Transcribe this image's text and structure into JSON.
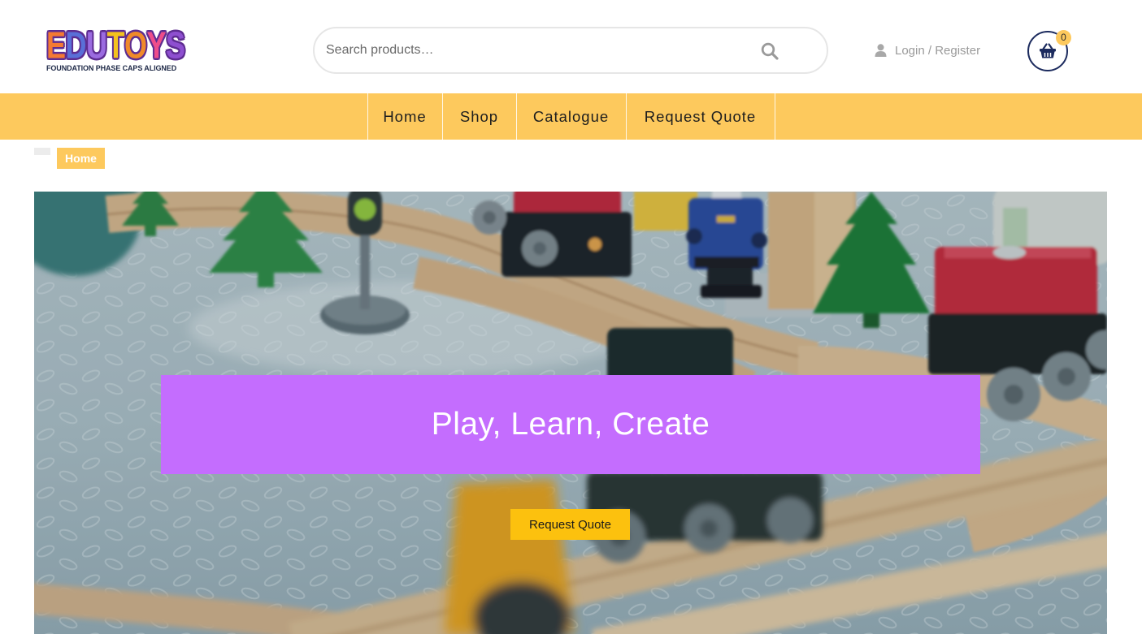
{
  "header": {
    "logo": {
      "letters": [
        {
          "char": "E",
          "color": "#f47a33"
        },
        {
          "char": "D",
          "color": "#5a6fd8"
        },
        {
          "char": "U",
          "color": "#9b6be0"
        },
        {
          "char": "T",
          "color": "#f4c21e"
        },
        {
          "char": "O",
          "color": "#f08a2a"
        },
        {
          "char": "Y",
          "color": "#ee4d8a"
        },
        {
          "char": "S",
          "color": "#8e4fd0"
        }
      ],
      "outline_color": "#5e2d91",
      "tagline": "FOUNDATION PHASE CAPS ALIGNED"
    },
    "search": {
      "placeholder": "Search products…",
      "value": "",
      "icon": "search-icon"
    },
    "account": {
      "icon": "user-icon",
      "label": "Login / Register"
    },
    "cart": {
      "icon": "basket-icon",
      "count": "0",
      "color": "#1c2b5e",
      "badge_color": "#fdc95d"
    }
  },
  "nav": {
    "background": "#fdc95d",
    "items": [
      {
        "label": "Home"
      },
      {
        "label": "Shop"
      },
      {
        "label": "Catalogue"
      },
      {
        "label": "Request Quote"
      }
    ]
  },
  "breadcrumb": {
    "active_color": "#fdc95d",
    "items": [
      {
        "label": ""
      },
      {
        "label": "Home",
        "active": true
      }
    ]
  },
  "hero": {
    "title": "Play, Learn, Create",
    "title_background": "#c46dfe",
    "button_label": "Request Quote",
    "button_color": "#fcc10e"
  }
}
